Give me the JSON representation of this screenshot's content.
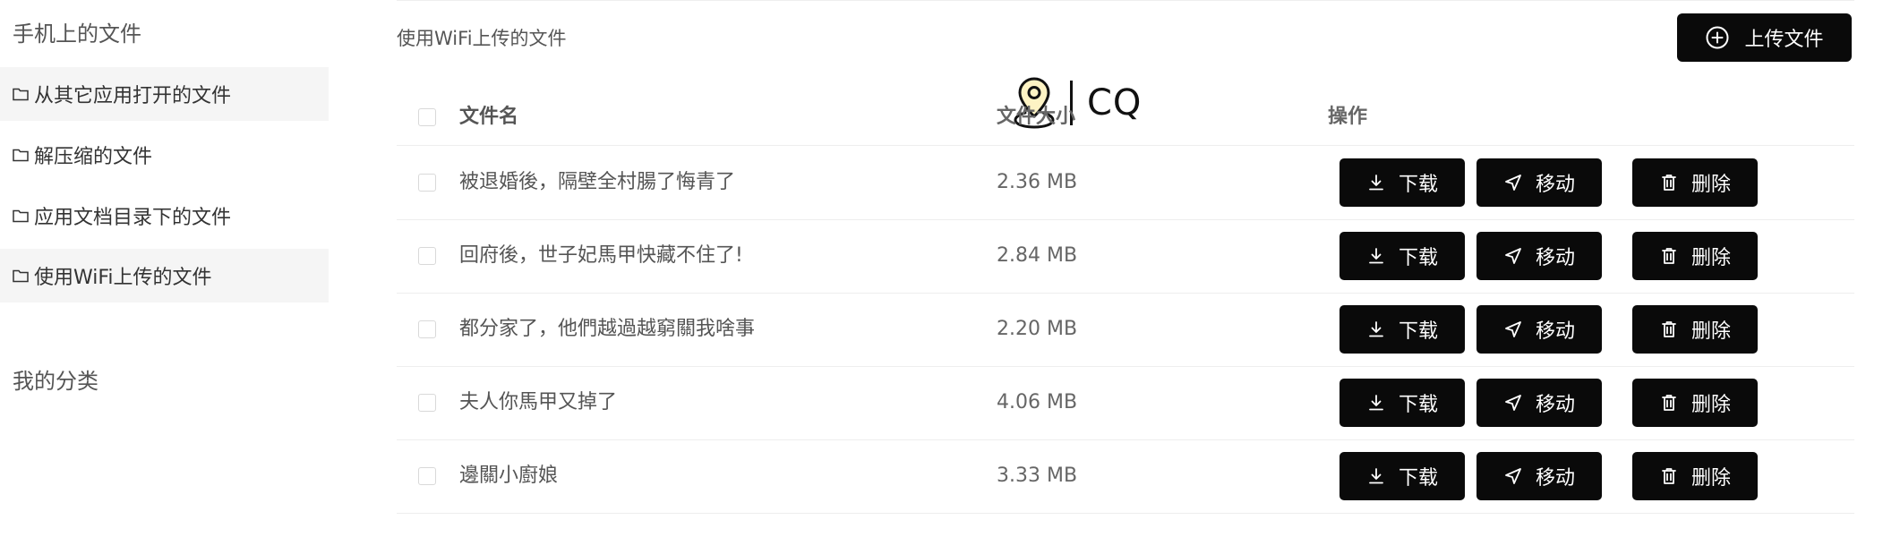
{
  "sidebar": {
    "section_files_title": "手机上的文件",
    "items": [
      {
        "label": "从其它应用打开的文件",
        "active": true
      },
      {
        "label": "解压缩的文件",
        "active": false
      },
      {
        "label": "应用文档目录下的文件",
        "active": false
      },
      {
        "label": "使用WiFi上传的文件",
        "active": true
      }
    ],
    "section_categories_title": "我的分类"
  },
  "main": {
    "title": "使用WiFi上传的文件",
    "upload_button_label": "上传文件",
    "watermark_text": "CQ",
    "table": {
      "columns": {
        "name": "文件名",
        "size": "文件大小",
        "actions": "操作"
      },
      "rows": [
        {
          "name": "被退婚後，隔壁全村腸了悔青了",
          "size": "2.36 MB"
        },
        {
          "name": "回府後，世子妃馬甲快藏不住了!",
          "size": "2.84 MB"
        },
        {
          "name": "都分家了，他們越過越窮關我啥事",
          "size": "2.20 MB"
        },
        {
          "name": "夫人你馬甲又掉了",
          "size": "4.06 MB"
        },
        {
          "name": "邊關小廚娘",
          "size": "3.33 MB"
        }
      ],
      "actions": {
        "download": "下载",
        "move": "移动",
        "delete": "删除"
      }
    }
  },
  "icons": {
    "folder": "folder-icon",
    "upload": "plus-circle-icon",
    "download": "download-icon",
    "move": "send-icon",
    "delete": "trash-icon",
    "watermark": "location-pin-icon"
  },
  "colors": {
    "button_bg": "#0a0a0a",
    "button_text": "#ffffff",
    "active_item_bg": "#f5f5f5",
    "divider": "#eeeeee"
  }
}
